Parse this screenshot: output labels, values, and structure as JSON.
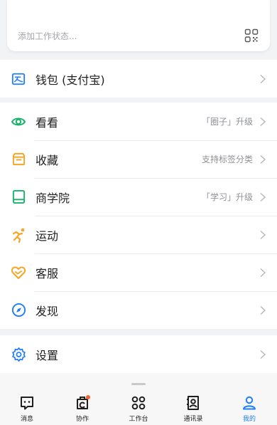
{
  "status_card": {
    "placeholder": "添加工作状态..."
  },
  "wallet": {
    "label": "钱包 (支付宝)"
  },
  "menu": [
    {
      "label": "看看",
      "hint": "「圈子」升级"
    },
    {
      "label": "收藏",
      "hint": "支持标签分类"
    },
    {
      "label": "商学院",
      "hint": "「学习」升级"
    },
    {
      "label": "运动",
      "hint": ""
    },
    {
      "label": "客服",
      "hint": ""
    },
    {
      "label": "发现",
      "hint": ""
    }
  ],
  "settings": {
    "label": "设置"
  },
  "tabs": [
    {
      "label": "消息",
      "icon": "message-icon"
    },
    {
      "label": "协作",
      "icon": "collab-icon",
      "badge": true
    },
    {
      "label": "工作台",
      "icon": "workbench-icon"
    },
    {
      "label": "通讯录",
      "icon": "contacts-icon"
    },
    {
      "label": "我的",
      "icon": "profile-icon",
      "active": true
    }
  ],
  "colors": {
    "accent": "#1f7ef9",
    "green": "#19b36b",
    "orange": "#f5a623",
    "badge": "#ff5a2c"
  }
}
